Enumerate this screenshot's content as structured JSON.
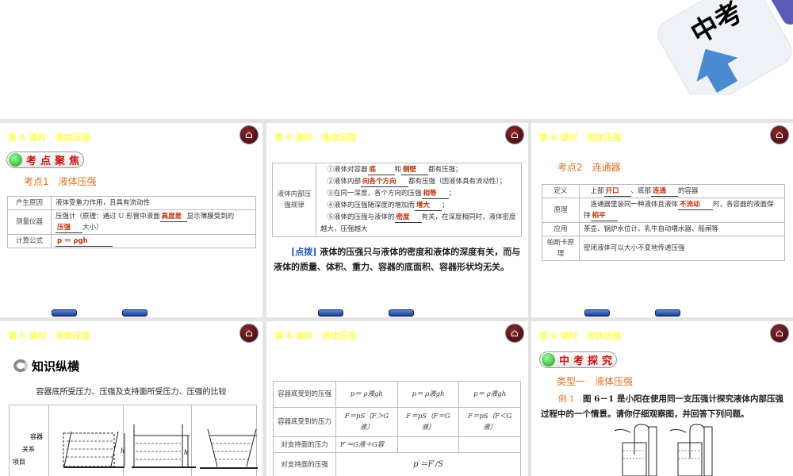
{
  "header": {
    "logo_text": "中考"
  },
  "slide_title": "第 6 课时　液体压强",
  "nav_buttons": [
    "考点聚焦",
    "中考探究"
  ],
  "slide1": {
    "badge": "考点聚焦",
    "section": "考点1　液体压强",
    "rows": [
      {
        "label": "产生原因",
        "text": "液体受重力作用，且具有流动性"
      },
      {
        "label": "测量仪器",
        "t1": "压强计（原理：通过 U 形管中液面",
        "a1": "高度差",
        "t2": "显示薄膜受到的",
        "a2": "压强",
        "t3": "大小）"
      },
      {
        "label": "计算公式",
        "a1": "p ＝ ρgh"
      }
    ]
  },
  "slide2": {
    "label": "液体内部压强规律",
    "items": [
      {
        "t1": "①液体对容器",
        "a1": "底",
        "t2": "和",
        "a2": "侧壁",
        "t3": "都有压强；"
      },
      {
        "t1": "②液体内部",
        "a1": "向各个方向",
        "t2": "都有压强（因液体具有流动性）；"
      },
      {
        "t1": "③在同一深度，各个方向的压强",
        "a1": "相等",
        "t2": "；"
      },
      {
        "t1": "④液体的压强随深度的增加而",
        "a1": "增大",
        "t2": "；"
      },
      {
        "t1": "⑤液体的压强与液体的",
        "a1": "密度",
        "t2": "有关，在深度相同时，液体密度越大，压强越大"
      }
    ],
    "tip_label": "[点拨]",
    "tip": "液体的压强只与液体的密度和液体的深度有关，而与液体的质量、体积、重力、容器的底面积、容器形状均无关。"
  },
  "slide3": {
    "section": "考点2　连通器",
    "rows": [
      {
        "label": "定义",
        "t1": "上部",
        "a1": "开口",
        "t2": "、底部",
        "a2": "连通",
        "t3": "的容器"
      },
      {
        "label": "原理",
        "t1": "连通器里装同一种液体且液体",
        "a1": "不流动",
        "t2": "时，各容器的液面保持",
        "a2": "相平"
      },
      {
        "label": "应用",
        "text": "茶壶、锅炉水位计、乳牛自动喂水器、船闸等"
      },
      {
        "label": "帕斯卡原理",
        "text": "密闭液体可以大小不变地传递压强"
      }
    ]
  },
  "slide4": {
    "heading": "知识纵横",
    "subtitle": "容器底所受压力、压强及支持面所受压力、压强的比较",
    "corner": [
      "容器",
      "关系",
      "项目"
    ],
    "h": "h"
  },
  "slide5": {
    "rows": [
      {
        "label": "容器底受到的压强",
        "c": [
          "p＝ ρ液gh",
          "p＝ ρ液gh",
          "p＝ ρ液gh"
        ]
      },
      {
        "label": "容器底受到的压力",
        "c": [
          "F＝pS（F＞G液）",
          "F＝pS（F＝G液）",
          "F＝pS（F＜G液）"
        ]
      },
      {
        "label": "对支持面的压力",
        "c": [
          "F′＝G液＋G容"
        ]
      },
      {
        "label": "对支持面的压强",
        "c": [
          "p′＝F′/S"
        ]
      }
    ]
  },
  "slide6": {
    "badge": "中考探究",
    "section": "类型一　液体压强",
    "example_label": "例 1",
    "example": "图 6－1 是小阳在使用同一支压强计探究液体内部压强过程中的一个情景。请你仔细观察图，并回答下列问题。"
  }
}
